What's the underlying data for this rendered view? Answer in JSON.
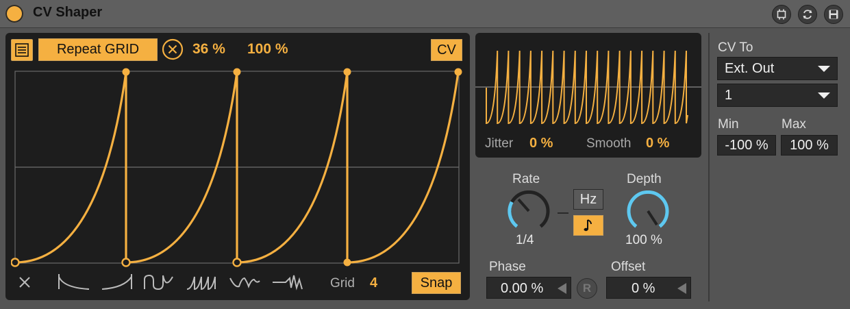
{
  "header": {
    "title": "CV Shaper"
  },
  "editor": {
    "repeat_label": "Repeat GRID",
    "value1": "36 %",
    "value2": "100 %",
    "cv_label": "CV",
    "grid_label": "Grid",
    "grid_value": "4",
    "snap_label": "Snap"
  },
  "modulation": {
    "jitter_label": "Jitter",
    "jitter_value": "0 %",
    "smooth_label": "Smooth",
    "smooth_value": "0 %",
    "rate_label": "Rate",
    "rate_value": "1/4",
    "hz_label": "Hz",
    "depth_label": "Depth",
    "depth_value": "100 %",
    "phase_label": "Phase",
    "phase_value": "0.00 %",
    "reset_label": "R",
    "offset_label": "Offset",
    "offset_value": "0 %"
  },
  "output": {
    "cv_to_label": "CV To",
    "destination": "Ext. Out",
    "channel": "1",
    "min_label": "Min",
    "min_value": "-100 %",
    "max_label": "Max",
    "max_value": "100 %"
  },
  "colors": {
    "accent": "#f5b041",
    "knob_ring": "#5ec8f0",
    "background": "#545454",
    "panel": "#1d1d1d"
  }
}
